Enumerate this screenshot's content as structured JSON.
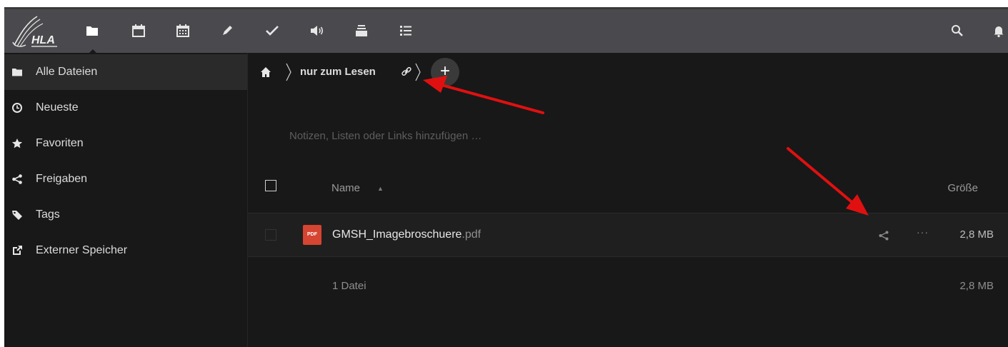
{
  "header": {
    "logo_text": "HLA",
    "apps": [
      {
        "name": "Dateien",
        "icon": "folder-icon"
      },
      {
        "name": "Kalender",
        "icon": "calendar-icon"
      },
      {
        "name": "Termine",
        "icon": "calendar-grid-icon"
      },
      {
        "name": "Notizen",
        "icon": "pencil-icon"
      },
      {
        "name": "Aufgaben",
        "icon": "checkmark-icon"
      },
      {
        "name": "Ankündigungen",
        "icon": "speaker-icon"
      },
      {
        "name": "Archiv",
        "icon": "archive-icon"
      },
      {
        "name": "Listen",
        "icon": "list-icon"
      }
    ],
    "search_icon": "search-icon",
    "notifications_icon": "bell-icon"
  },
  "sidebar": {
    "items": [
      {
        "label": "Alle Dateien",
        "icon": "folder-icon",
        "active": true
      },
      {
        "label": "Neueste",
        "icon": "clock-icon"
      },
      {
        "label": "Favoriten",
        "icon": "star-icon"
      },
      {
        "label": "Freigaben",
        "icon": "share-icon"
      },
      {
        "label": "Tags",
        "icon": "tag-icon"
      },
      {
        "label": "Externer Speicher",
        "icon": "external-icon"
      }
    ]
  },
  "breadcrumb": {
    "home_icon": "home-icon",
    "current": "nur zum Lesen",
    "link_icon": "link-icon",
    "add_label": "+"
  },
  "notes_placeholder": "Notizen, Listen oder Links hinzufügen …",
  "table": {
    "col_name": "Name",
    "sort_indicator": "▲",
    "col_size": "Größe",
    "files": [
      {
        "name": "GMSH_Imagebroschuere",
        "ext": ".pdf",
        "icon_label": "PDF",
        "size": "2,8 MB"
      }
    ],
    "more_label": "···",
    "summary": {
      "count": "1 Datei",
      "size": "2,8 MB"
    }
  },
  "colors": {
    "header_bg": "#4a4a4e",
    "content_bg": "#181818",
    "active_item_bg": "#2a2a2a",
    "pdf_icon": "#d64432",
    "annotation_arrow": "#e01010"
  }
}
